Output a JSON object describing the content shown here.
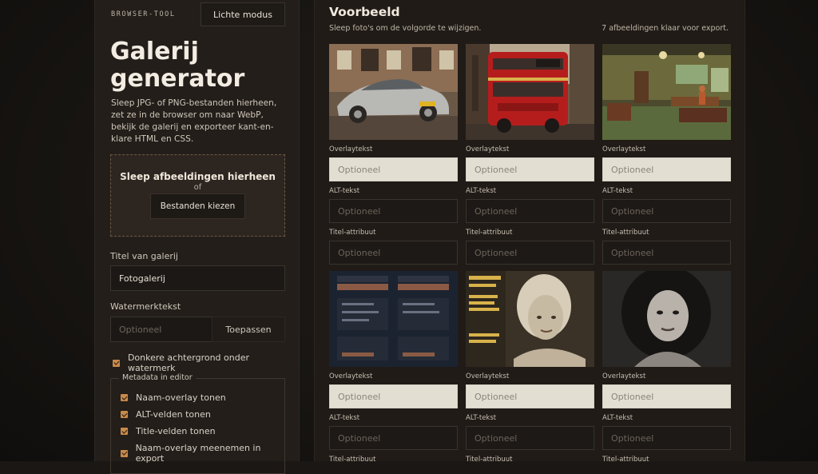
{
  "sidebar": {
    "brand": "BROWSER-TOOL",
    "mode_button": "Lichte modus",
    "title_line1": "Galerij",
    "title_line2": "generator",
    "intro": "Sleep JPG- of PNG-bestanden hierheen, zet ze in de browser om naar WebP, bekijk de galerij en exporteer kant-en-klare HTML en CSS.",
    "dropzone": {
      "title": "Sleep afbeeldingen hierheen",
      "or": "of",
      "button": "Bestanden kiezen"
    },
    "gallery_title_label": "Titel van galerij",
    "gallery_title_value": "Fotogalerij",
    "watermark_label": "Watermerktekst",
    "watermark_placeholder": "Optioneel",
    "apply_button": "Toepassen",
    "dark_bg_label": "Donkere achtergrond onder watermerk",
    "metadata_legend": "Metadata in editor",
    "metadata_options": [
      "Naam-overlay tonen",
      "ALT-velden tonen",
      "Title-velden tonen",
      "Naam-overlay meenemen in export"
    ]
  },
  "main": {
    "title": "Voorbeeld",
    "hint": "Sleep foto's om de volgorde te wijzigen.",
    "count": "7 afbeeldingen klaar voor export.",
    "field_labels": {
      "overlay": "Overlaytekst",
      "alt": "ALT-tekst",
      "title": "Titel-attribuut"
    },
    "placeholder": "Optioneel",
    "images": [
      {
        "icon": "car-photo"
      },
      {
        "icon": "bus-photo"
      },
      {
        "icon": "diner-photo"
      },
      {
        "icon": "screenshot-photo"
      },
      {
        "icon": "magazine-cover-photo"
      },
      {
        "icon": "portrait-photo"
      }
    ]
  },
  "colors": {
    "accent": "#c98a4a",
    "background": "#1a1714",
    "panel": "#231e1a"
  }
}
